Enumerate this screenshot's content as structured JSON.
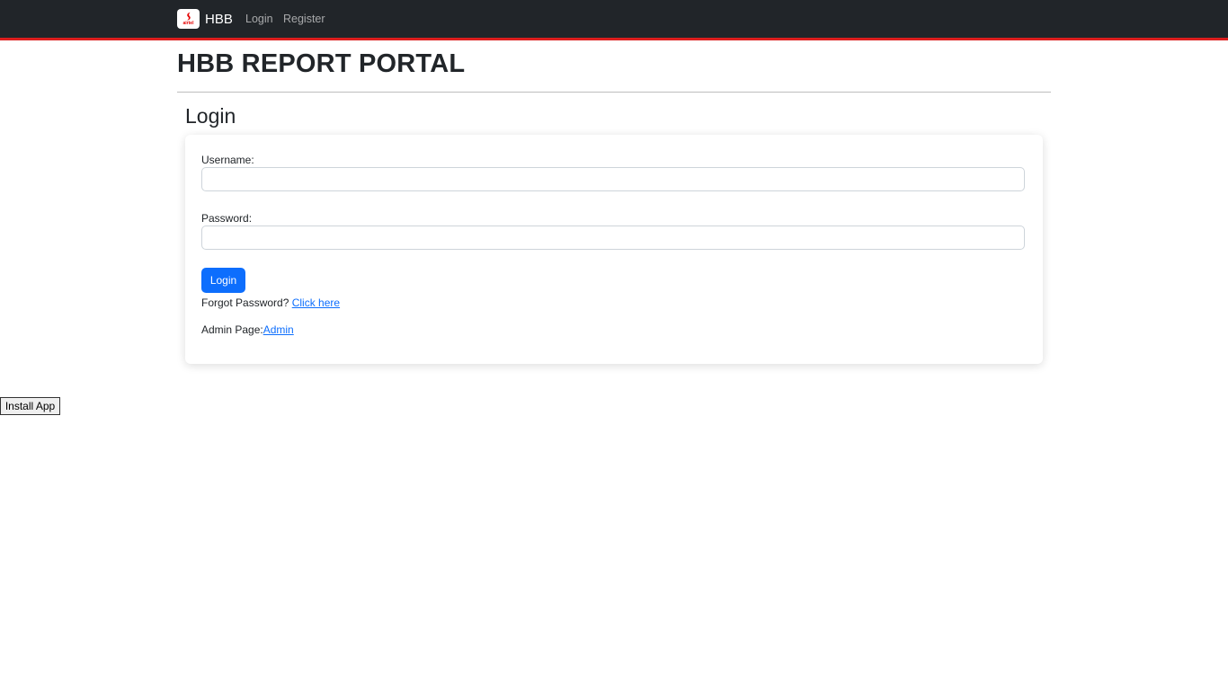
{
  "navbar": {
    "brand": "HBB",
    "logo_text": "airtel",
    "links": [
      {
        "label": "Login"
      },
      {
        "label": "Register"
      }
    ]
  },
  "page": {
    "title": "HBB REPORT PORTAL",
    "section_heading": "Login"
  },
  "form": {
    "username_label": "Username:",
    "username_value": "",
    "password_label": "Password:",
    "password_value": "",
    "login_button": "Login",
    "forgot_prefix": "Forgot Password? ",
    "forgot_link": "Click here",
    "admin_prefix": "Admin Page:",
    "admin_link": "Admin"
  },
  "install_button": "Install App",
  "colors": {
    "navbar_bg": "#212529",
    "navbar_accent": "#dc1e1e",
    "primary": "#0d6efd"
  },
  "icons": {
    "brand_logo": "airtel-logo-icon"
  }
}
